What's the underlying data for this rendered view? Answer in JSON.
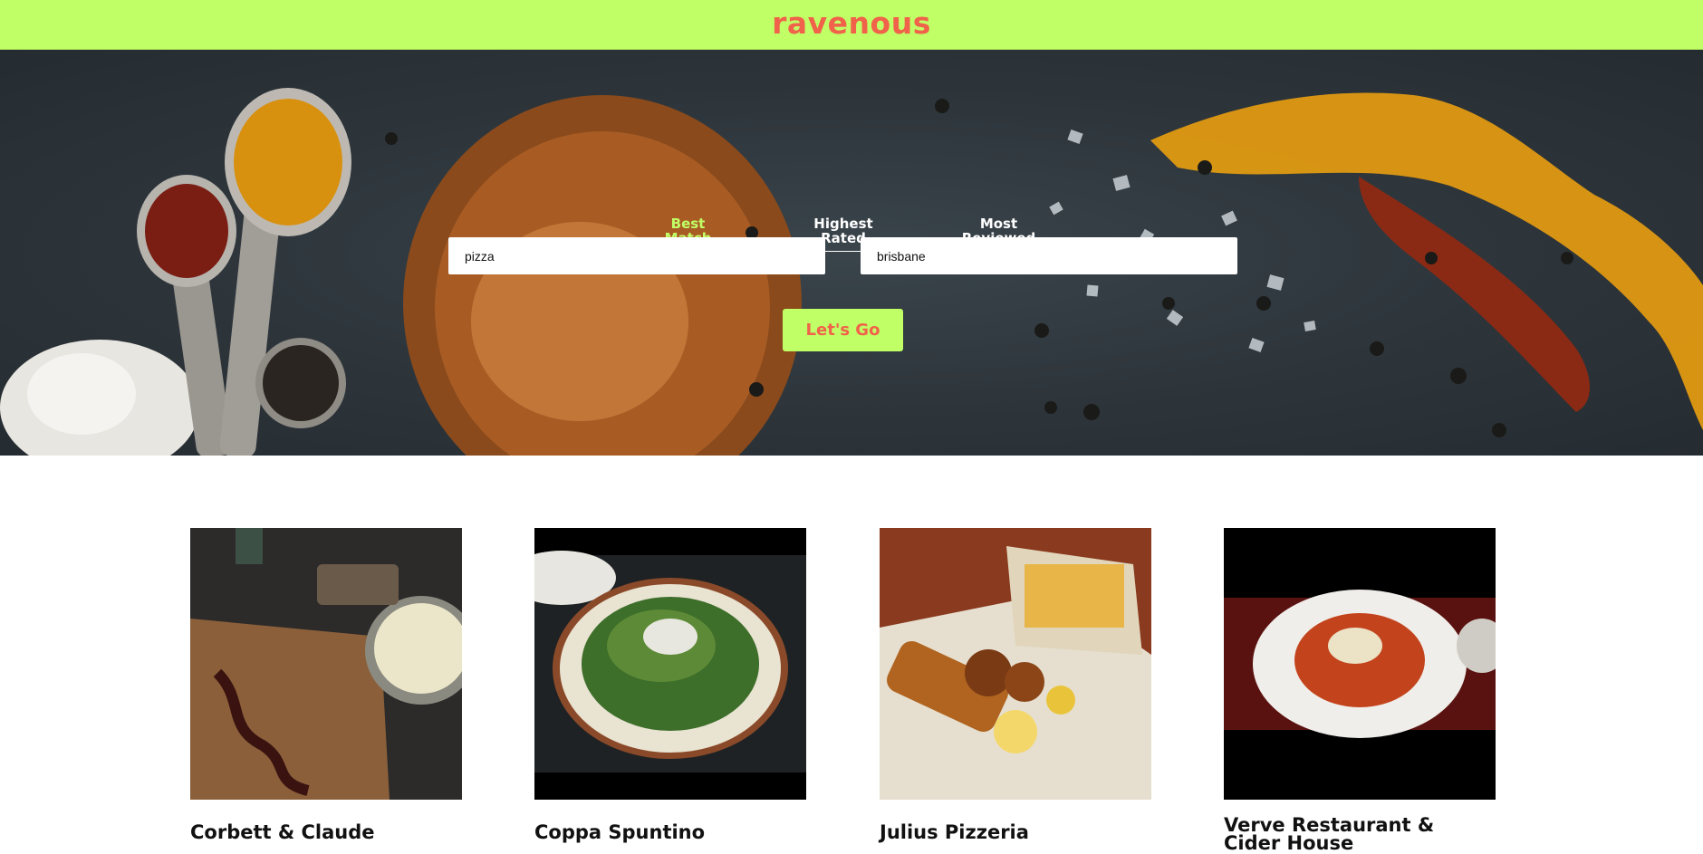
{
  "app": {
    "logo": "ravenous"
  },
  "colors": {
    "accent": "#c1ff66",
    "brand": "#f0624a"
  },
  "sort_options": [
    {
      "line1": "Best",
      "line2": "Match",
      "active": true
    },
    {
      "line1": "Highest",
      "line2": "Rated",
      "active": false
    },
    {
      "line1": "Most",
      "line2": "Reviewed",
      "active": false
    }
  ],
  "search": {
    "term_value": "pizza",
    "location_value": "brisbane",
    "submit_label": "Let's Go"
  },
  "businesses": [
    {
      "name": "Corbett & Claude",
      "photo": "food-photo-icon"
    },
    {
      "name": "Coppa Spuntino",
      "photo": "salad-photo-icon"
    },
    {
      "name": "Julius Pizzeria",
      "photo": "fish-and-chips-photo-icon"
    },
    {
      "name": "Verve Restaurant & Cider House",
      "photo": "pasta-photo-icon"
    }
  ]
}
